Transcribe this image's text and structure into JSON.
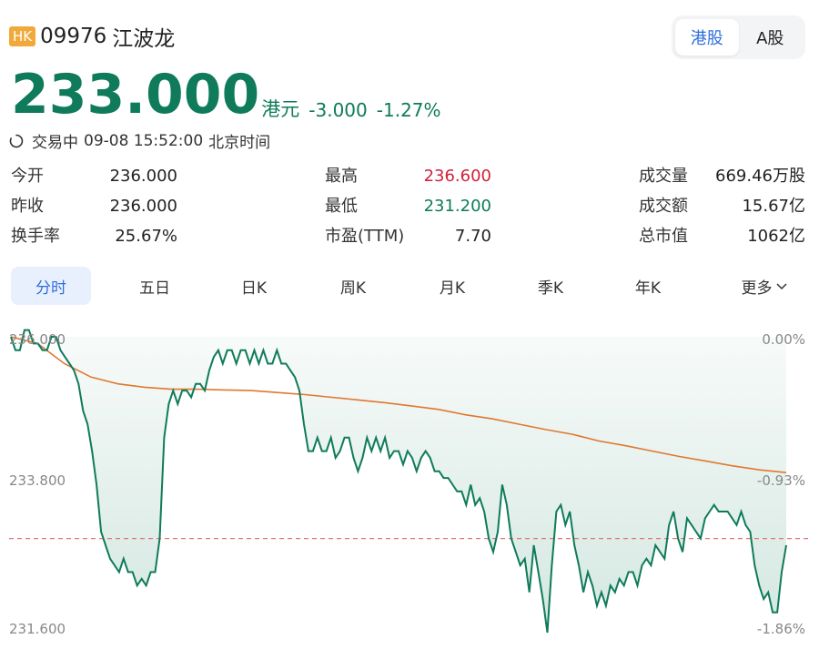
{
  "header": {
    "market_badge": "HK",
    "code": "09976",
    "name": "江波龙"
  },
  "market_toggle": {
    "options": [
      "港股",
      "A股"
    ],
    "selected": "港股"
  },
  "quote": {
    "price": "233.000",
    "unit": "港元",
    "change": "-3.000",
    "change_pct": "-1.27%",
    "status": "交易中",
    "datetime": "09-08 15:52:00",
    "timezone": "北京时间"
  },
  "stats": [
    [
      {
        "label": "今开",
        "value": "236.000"
      },
      {
        "label": "最高",
        "value": "236.600",
        "tone": "up"
      },
      {
        "label": "成交量",
        "value": "669.46万股"
      }
    ],
    [
      {
        "label": "昨收",
        "value": "236.000"
      },
      {
        "label": "最低",
        "value": "231.200",
        "tone": "down"
      },
      {
        "label": "成交额",
        "value": "15.67亿"
      }
    ],
    [
      {
        "label": "换手率",
        "value": "25.67%"
      },
      {
        "label": "市盈(TTM)",
        "value": "7.70"
      },
      {
        "label": "总市值",
        "value": "1062亿"
      }
    ]
  ],
  "tabs": [
    "分时",
    "五日",
    "日K",
    "周K",
    "月K",
    "季K",
    "年K",
    "更多"
  ],
  "active_tab": "分时",
  "colors": {
    "down": "#0f7b5a",
    "up": "#d0213a",
    "accent": "#2f6fdb",
    "avg_line": "#e0782f",
    "ref_line": "#e57373"
  },
  "chart_data": {
    "type": "line",
    "title": "",
    "y_left_ticks": [
      "236.000",
      "233.800",
      "231.600"
    ],
    "y_right_ticks": [
      "0.00%",
      "-0.93%",
      "-1.86%"
    ],
    "ylim": [
      231.6,
      236.0
    ],
    "prev_close": 236.0,
    "current_price": 233.0,
    "series": [
      {
        "role": "price",
        "values": [
          236.0,
          235.8,
          235.8,
          236.1,
          236.1,
          235.9,
          235.9,
          235.8,
          235.8,
          236.0,
          236.0,
          235.8,
          235.7,
          235.6,
          235.5,
          235.3,
          234.9,
          234.7,
          234.3,
          233.8,
          233.1,
          232.9,
          232.7,
          232.6,
          232.5,
          232.7,
          232.5,
          232.5,
          232.3,
          232.4,
          232.3,
          232.5,
          232.5,
          233.0,
          234.5,
          235.0,
          235.2,
          235.0,
          235.2,
          235.2,
          235.1,
          235.3,
          235.3,
          235.2,
          235.5,
          235.7,
          235.8,
          235.6,
          235.8,
          235.8,
          235.6,
          235.8,
          235.8,
          235.6,
          235.8,
          235.6,
          235.8,
          235.6,
          235.6,
          235.8,
          235.6,
          235.6,
          235.5,
          235.4,
          235.2,
          234.7,
          234.3,
          234.3,
          234.5,
          234.3,
          234.3,
          234.5,
          234.2,
          234.3,
          234.5,
          234.5,
          234.2,
          234.0,
          234.2,
          234.5,
          234.3,
          234.5,
          234.3,
          234.5,
          234.2,
          234.3,
          234.3,
          234.1,
          234.3,
          234.2,
          234.0,
          234.2,
          234.3,
          234.2,
          234.0,
          234.0,
          233.9,
          233.9,
          233.8,
          233.7,
          233.7,
          233.5,
          233.8,
          233.5,
          233.6,
          233.4,
          233.0,
          232.8,
          233.1,
          233.8,
          233.5,
          233.0,
          232.8,
          232.6,
          232.7,
          232.2,
          232.9,
          232.5,
          232.1,
          231.6,
          232.6,
          233.4,
          233.5,
          233.2,
          233.4,
          232.9,
          232.6,
          232.2,
          232.5,
          232.3,
          232.0,
          232.2,
          232.0,
          232.3,
          232.2,
          232.4,
          232.3,
          232.5,
          232.5,
          232.3,
          232.6,
          232.7,
          232.6,
          232.9,
          232.8,
          232.7,
          233.2,
          233.4,
          233.0,
          232.8,
          233.3,
          233.2,
          233.1,
          233.0,
          233.3,
          233.4,
          233.5,
          233.4,
          233.4,
          233.4,
          233.3,
          233.2,
          233.4,
          233.2,
          233.1,
          232.6,
          232.3,
          232.1,
          232.2,
          231.9,
          231.9,
          232.5,
          232.9
        ]
      },
      {
        "role": "average",
        "values": [
          236.0,
          235.9,
          235.6,
          235.4,
          235.3,
          235.25,
          235.22,
          235.22,
          235.21,
          235.2,
          235.17,
          235.14,
          235.1,
          235.06,
          235.02,
          234.97,
          234.92,
          234.84,
          234.78,
          234.7,
          234.62,
          234.55,
          234.45,
          234.38,
          234.3,
          234.22,
          234.15,
          234.08,
          234.02,
          233.98
        ]
      }
    ]
  }
}
